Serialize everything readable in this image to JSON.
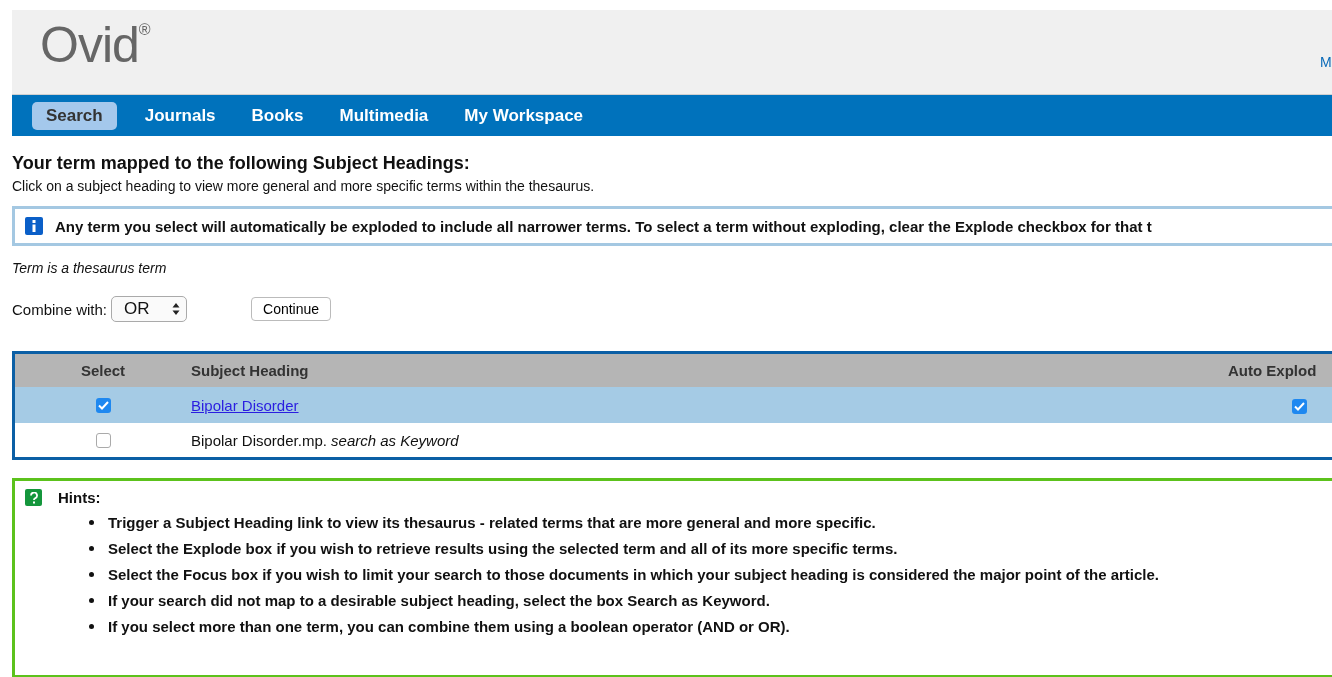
{
  "header": {
    "logo": "Ovid",
    "logo_mark": "®",
    "right_link": "M"
  },
  "nav": [
    {
      "label": "Search",
      "selected": true
    },
    {
      "label": "Journals",
      "selected": false
    },
    {
      "label": "Books",
      "selected": false
    },
    {
      "label": "Multimedia",
      "selected": false
    },
    {
      "label": "My Workspace",
      "selected": false
    }
  ],
  "title": "Your term mapped to the following Subject Headings:",
  "subtitle": "Click on a subject heading to view more general and more specific terms within the thesaurus.",
  "info_banner": "Any term you select will automatically be exploded to include all narrower terms. To select a term without exploding, clear the Explode checkbox for that t",
  "legend": "Term is a thesaurus term",
  "combine": {
    "label": "Combine with:",
    "value": "OR",
    "button": "Continue"
  },
  "table": {
    "columns": [
      "Select",
      "Subject Heading",
      "Auto Explod"
    ],
    "rows": [
      {
        "selected": true,
        "select_checked": true,
        "heading": "Bipolar Disorder",
        "kind": "link",
        "explode_checked": true
      },
      {
        "selected": false,
        "select_checked": false,
        "heading": "Bipolar Disorder.mp. *search as Keyword*",
        "kind": "text"
      }
    ]
  },
  "hints": {
    "title": "Hints:",
    "items": [
      "Trigger a Subject Heading link to view its thesaurus - related terms that are more general and more specific.",
      "Select the Explode box if you wish to retrieve results using the selected term and all of its more specific terms.",
      "Select the Focus box if you wish to limit your search to those documents in which your subject heading is considered the major point of the article.",
      "If your search did not map to a desirable subject heading, select the box Search as Keyword.",
      "If you select more than one term, you can combine them using a boolean operator (AND or OR)."
    ]
  }
}
